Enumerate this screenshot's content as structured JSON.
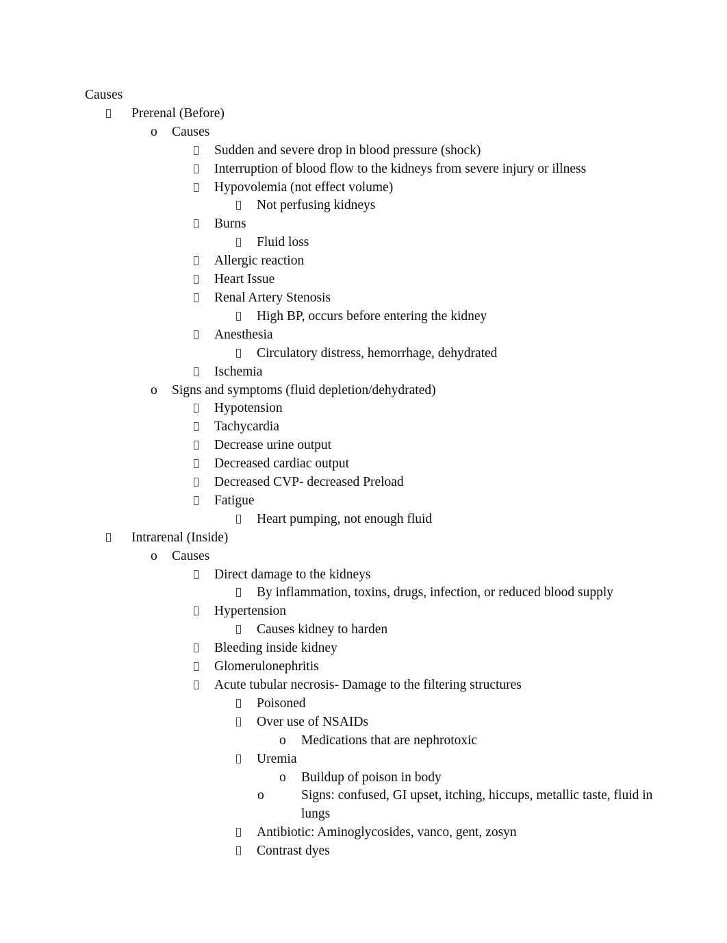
{
  "document": {
    "type": "outline-notes",
    "background_color": "#ffffff",
    "text_color": "#0d0d0d",
    "markers": {
      "level1": "tofu-box",
      "level2": "o",
      "level3": "tofu-box",
      "level4": "tofu-box",
      "level5": "o"
    },
    "title": "Causes",
    "lines": [
      {
        "level": 0,
        "marker": "none",
        "text": "Causes"
      },
      {
        "level": 1,
        "marker": "tofu",
        "text": "Prerenal (Before)"
      },
      {
        "level": 2,
        "marker": "o",
        "text": "Causes"
      },
      {
        "level": 3,
        "marker": "tofu",
        "text": "Sudden and severe drop in blood pressure (shock)"
      },
      {
        "level": 3,
        "marker": "tofu",
        "text": "Interruption of blood flow to the kidneys from severe injury or illness"
      },
      {
        "level": 3,
        "marker": "tofu",
        "text": "Hypovolemia (not effect volume)"
      },
      {
        "level": 4,
        "marker": "tofu",
        "text": "Not perfusing kidneys"
      },
      {
        "level": 3,
        "marker": "tofu",
        "text": "Burns"
      },
      {
        "level": 4,
        "marker": "tofu",
        "text": "Fluid loss"
      },
      {
        "level": 3,
        "marker": "tofu",
        "text": "Allergic reaction"
      },
      {
        "level": 3,
        "marker": "tofu",
        "text": "Heart Issue"
      },
      {
        "level": 3,
        "marker": "tofu",
        "text": "Renal Artery Stenosis"
      },
      {
        "level": 4,
        "marker": "tofu",
        "text": "High BP, occurs before entering the kidney"
      },
      {
        "level": 3,
        "marker": "tofu",
        "text": "Anesthesia"
      },
      {
        "level": 4,
        "marker": "tofu",
        "text": "Circulatory distress, hemorrhage, dehydrated"
      },
      {
        "level": 3,
        "marker": "tofu",
        "text": "Ischemia"
      },
      {
        "level": 2,
        "marker": "o",
        "text": "Signs and symptoms (fluid depletion/dehydrated)"
      },
      {
        "level": 3,
        "marker": "tofu",
        "text": "Hypotension"
      },
      {
        "level": 3,
        "marker": "tofu",
        "text": "Tachycardia"
      },
      {
        "level": 3,
        "marker": "tofu",
        "text": "Decrease urine output"
      },
      {
        "level": 3,
        "marker": "tofu",
        "text": "Decreased cardiac output"
      },
      {
        "level": 3,
        "marker": "tofu",
        "text": "Decreased CVP- decreased Preload"
      },
      {
        "level": 3,
        "marker": "tofu",
        "text": "Fatigue"
      },
      {
        "level": 4,
        "marker": "tofu",
        "text": "Heart pumping, not enough fluid"
      },
      {
        "level": 1,
        "marker": "tofu",
        "text": "Intrarenal (Inside)"
      },
      {
        "level": 2,
        "marker": "o",
        "text": "Causes"
      },
      {
        "level": 3,
        "marker": "tofu",
        "text": "Direct damage to the kidneys"
      },
      {
        "level": 4,
        "marker": "tofu",
        "text": "By inflammation, toxins, drugs, infection, or reduced blood supply"
      },
      {
        "level": 3,
        "marker": "tofu",
        "text": "Hypertension"
      },
      {
        "level": 4,
        "marker": "tofu",
        "text": "Causes kidney to harden"
      },
      {
        "level": 3,
        "marker": "tofu",
        "text": "Bleeding inside kidney"
      },
      {
        "level": 3,
        "marker": "tofu",
        "text": "Glomerulonephritis"
      },
      {
        "level": 3,
        "marker": "tofu",
        "text": "Acute tubular necrosis- Damage to the filtering structures"
      },
      {
        "level": 4,
        "marker": "tofu",
        "text": "Poisoned"
      },
      {
        "level": 4,
        "marker": "tofu",
        "text": "Over use of NSAIDs"
      },
      {
        "level": 5,
        "marker": "o",
        "text": "Medications that are nephrotoxic"
      },
      {
        "level": 4,
        "marker": "tofu",
        "text": "Uremia"
      },
      {
        "level": 5,
        "marker": "o",
        "text": "Buildup of poison in body"
      },
      {
        "level": 5,
        "marker": "o",
        "text": "Signs: confused, GI upset, itching, hiccups, metallic taste, fluid in lungs",
        "wraps": true
      },
      {
        "level": 4,
        "marker": "tofu",
        "text": "Antibiotic: Aminoglycosides, vanco, gent, zosyn"
      },
      {
        "level": 4,
        "marker": "tofu",
        "text": "Contrast dyes"
      }
    ]
  }
}
